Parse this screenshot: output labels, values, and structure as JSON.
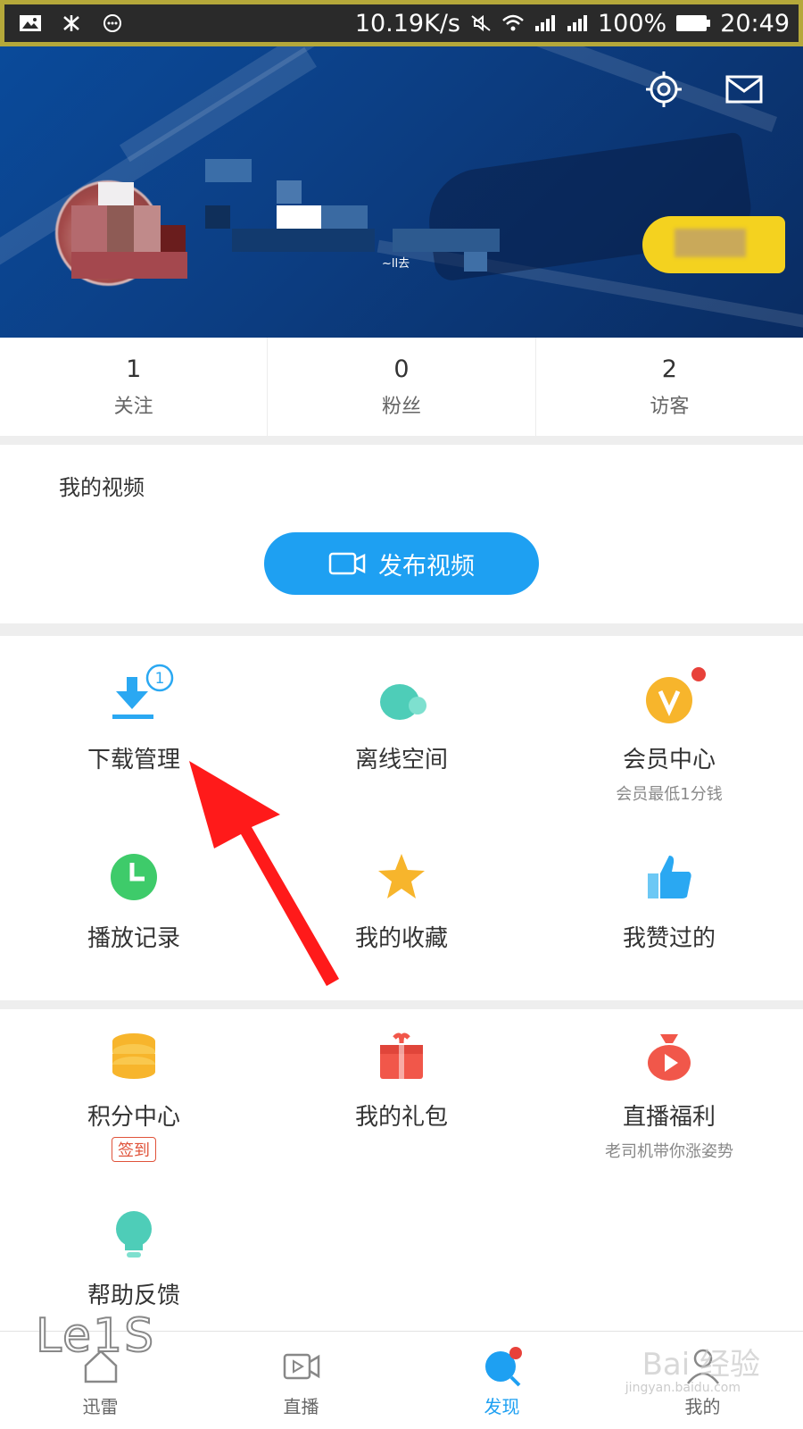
{
  "status_bar": {
    "speed": "10.19K/s",
    "battery": "100%",
    "time": "20:49"
  },
  "header": {
    "settings_icon": "gear-icon",
    "message_icon": "mail-icon",
    "nickname_partial": "~ll去"
  },
  "stats": [
    {
      "value": "1",
      "label": "关注"
    },
    {
      "value": "0",
      "label": "粉丝"
    },
    {
      "value": "2",
      "label": "访客"
    }
  ],
  "videos": {
    "title": "我的视频",
    "publish_label": "发布视频"
  },
  "grid1": [
    {
      "label": "下载管理",
      "badge": "1",
      "icon": "download-icon"
    },
    {
      "label": "离线空间",
      "icon": "cloud-icon"
    },
    {
      "label": "会员中心",
      "sub": "会员最低1分钱",
      "icon": "vip-icon"
    },
    {
      "label": "播放记录",
      "icon": "clock-icon"
    },
    {
      "label": "我的收藏",
      "icon": "star-icon"
    },
    {
      "label": "我赞过的",
      "icon": "thumbs-up-icon"
    }
  ],
  "grid2": [
    {
      "label": "积分中心",
      "tag": "签到",
      "icon": "coins-icon"
    },
    {
      "label": "我的礼包",
      "icon": "gift-icon"
    },
    {
      "label": "直播福利",
      "sub": "老司机带你涨姿势",
      "icon": "money-bag-icon"
    },
    {
      "label": "帮助反馈",
      "icon": "lightbulb-icon"
    }
  ],
  "bottom_nav": [
    {
      "label": "迅雷",
      "icon": "home-icon"
    },
    {
      "label": "直播",
      "icon": "video-icon"
    },
    {
      "label": "发现",
      "icon": "discover-icon",
      "active": true
    },
    {
      "label": "我的",
      "icon": "user-icon"
    }
  ],
  "watermarks": {
    "left": "Le1S",
    "right": "Bai 经验",
    "right_sub": "jingyan.baidu.com"
  },
  "colors": {
    "accent": "#1ea0f2",
    "header_blue": "#0c3f85",
    "vip_yellow": "#f4d21f",
    "red_dot": "#e8413a",
    "arrow_red": "#ff1a1a"
  }
}
